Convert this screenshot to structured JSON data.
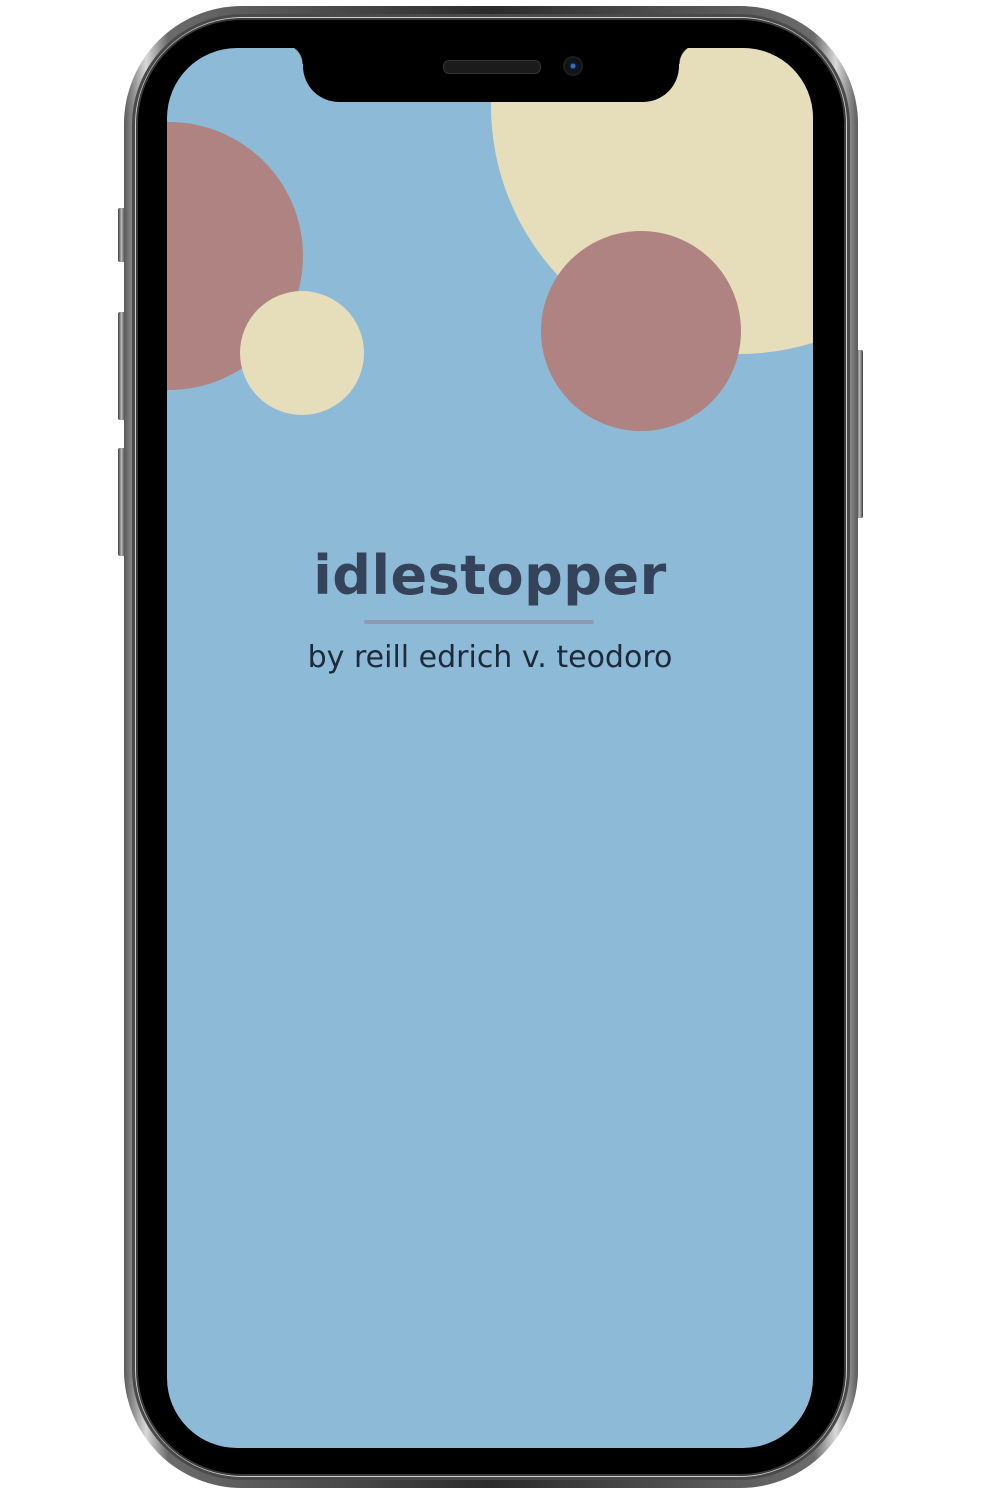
{
  "app": {
    "title": "idlestopper",
    "byline": "by reill edrich v. teodoro"
  },
  "colors": {
    "background": "#8dbad6",
    "rose": "#af8381",
    "cream": "#e6ddbb",
    "title_text": "#34435a",
    "underline": "#8d9cb0"
  },
  "icons": {
    "front_camera": "camera-icon",
    "earpiece": "speaker-icon"
  }
}
